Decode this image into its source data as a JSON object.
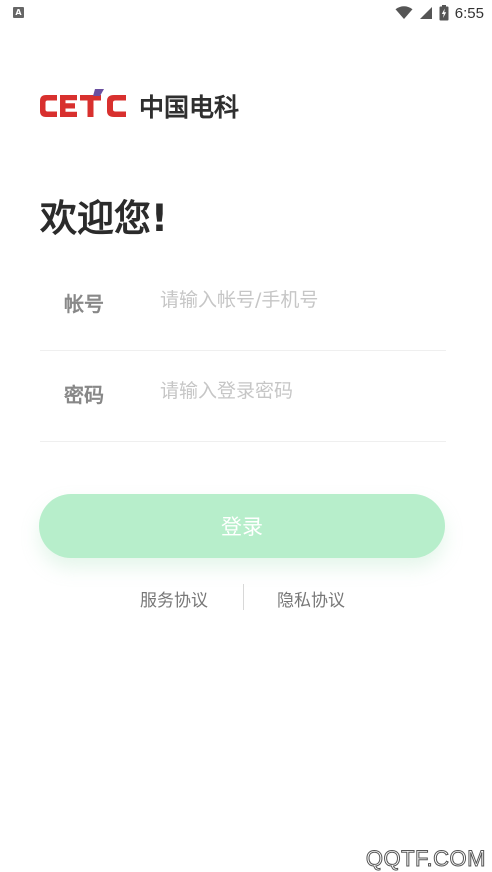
{
  "status_bar": {
    "notification_icon": "a-notification-icon",
    "wifi_icon": "wifi-icon",
    "signal_icon": "signal-icon",
    "battery_icon": "battery-icon",
    "time": "6:55"
  },
  "logo": {
    "en_text": "CETC",
    "cn_text": "中国电科",
    "brand_red": "#d8302e",
    "brand_purple": "#6a4fa0"
  },
  "welcome": "欢迎您!",
  "form": {
    "account_label": "帐号",
    "account_placeholder": "请输入帐号/手机号",
    "account_value": "",
    "password_label": "密码",
    "password_placeholder": "请输入登录密码",
    "password_value": ""
  },
  "login_button": {
    "label": "登录",
    "color": "#b7eecb"
  },
  "agreements": {
    "service": "服务协议",
    "privacy": "隐私协议"
  },
  "watermark": "QQTF.COM"
}
